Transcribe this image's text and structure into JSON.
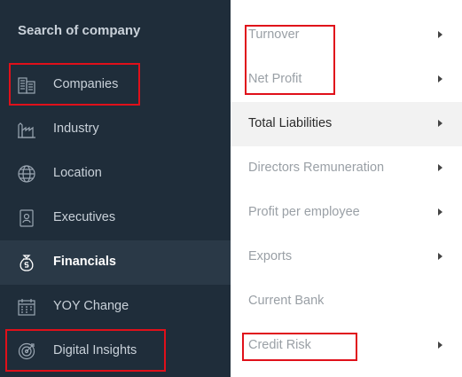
{
  "sidebar": {
    "search_label": "Search of company",
    "items": [
      {
        "label": "Companies",
        "icon": "building-icon"
      },
      {
        "label": "Industry",
        "icon": "factory-icon"
      },
      {
        "label": "Location",
        "icon": "globe-icon"
      },
      {
        "label": "Executives",
        "icon": "id-card-icon"
      },
      {
        "label": "Financials",
        "icon": "money-bag-icon"
      },
      {
        "label": "YOY Change",
        "icon": "calendar-icon"
      },
      {
        "label": "Digital Insights",
        "icon": "target-icon"
      }
    ],
    "active_item": "Financials"
  },
  "financials_menu": {
    "items": [
      {
        "label": "Turnover",
        "has_submenu": true
      },
      {
        "label": "Net Profit",
        "has_submenu": true
      },
      {
        "label": "Total Liabilities",
        "has_submenu": true
      },
      {
        "label": "Directors Remuneration",
        "has_submenu": true
      },
      {
        "label": "Profit per employee",
        "has_submenu": true
      },
      {
        "label": "Exports",
        "has_submenu": true
      },
      {
        "label": "Current Bank",
        "has_submenu": false
      },
      {
        "label": "Credit Risk",
        "has_submenu": true
      }
    ],
    "active_item": "Total Liabilities"
  },
  "colors": {
    "sidebar_bg": "#1f2d3a",
    "sidebar_active_bg": "#2a3947",
    "sidebar_text": "#c9d1d9",
    "menu_text_muted": "#9aa0a6",
    "menu_active_bg": "#f2f2f2",
    "highlight_box": "#e0101a"
  }
}
